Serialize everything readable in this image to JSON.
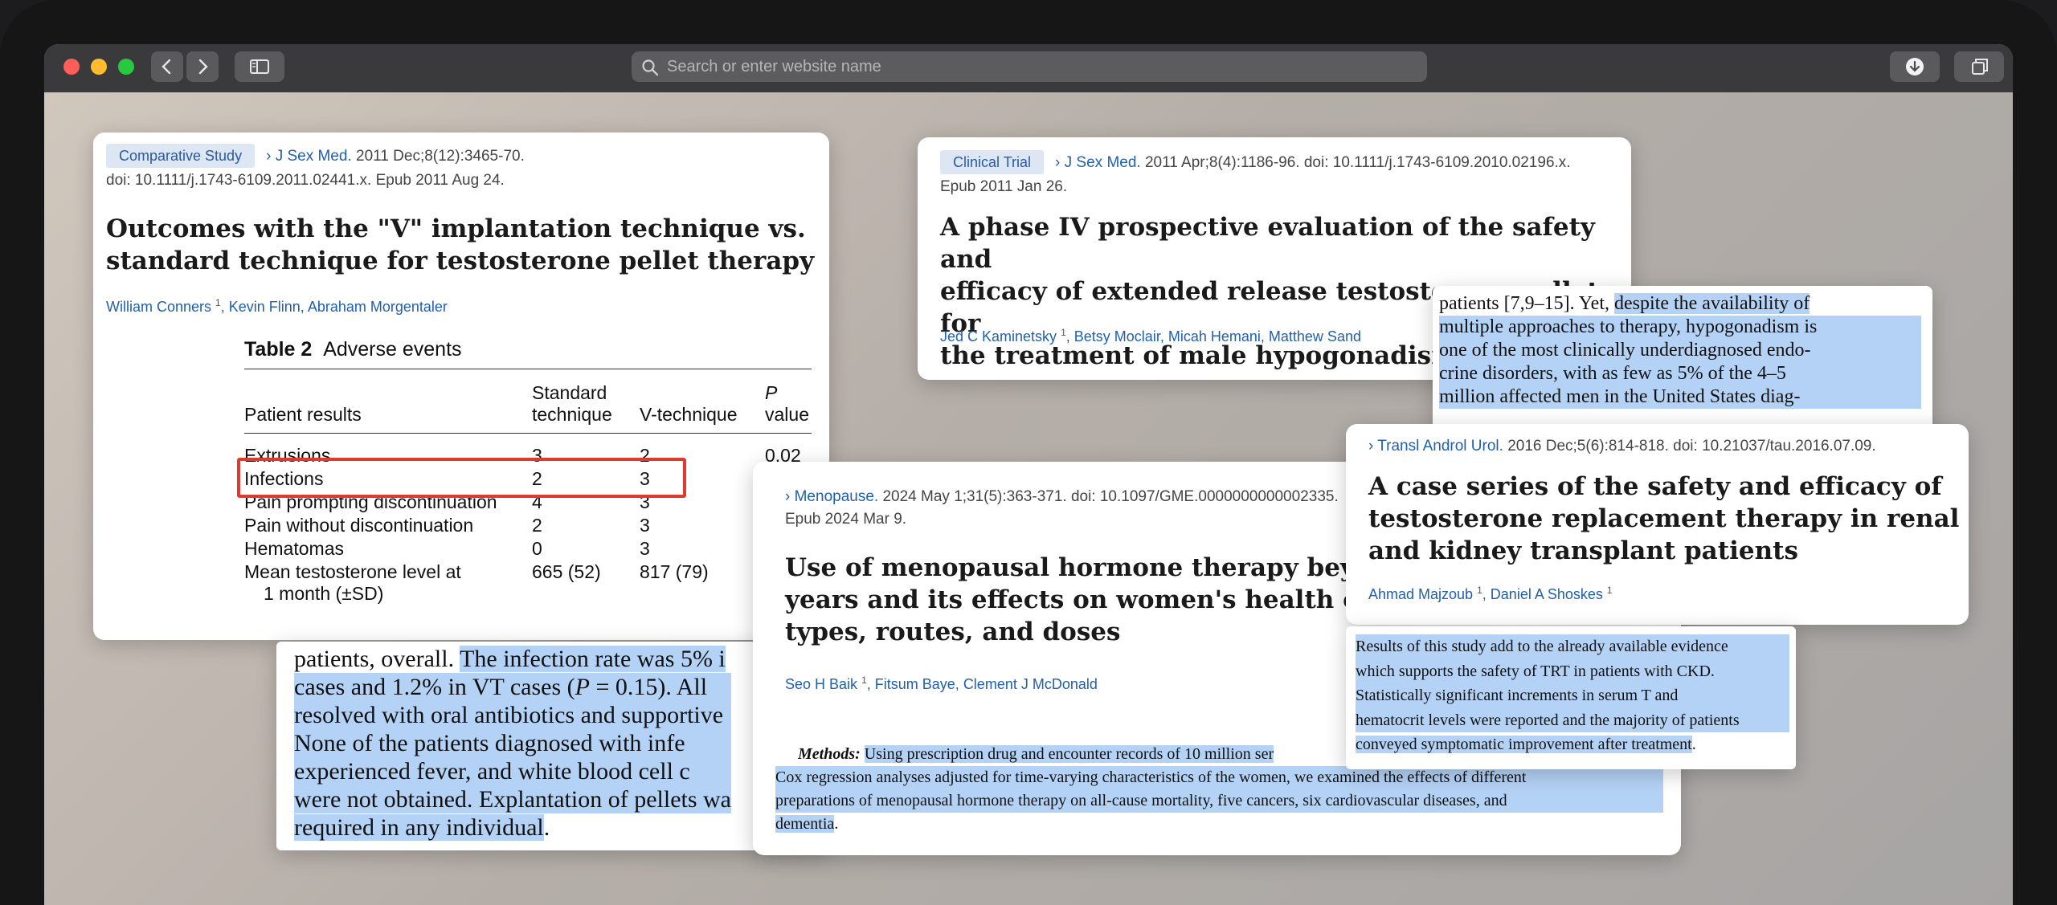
{
  "browser": {
    "search_placeholder": "Search or enter website name"
  },
  "card1": {
    "badge": "Comparative Study",
    "journal": "J Sex Med.",
    "citation": "2011 Dec;8(12):3465-70.",
    "doi_line": "doi: 10.1111/j.1743-6109.2011.02441.x. Epub 2011 Aug 24.",
    "title_line1": "Outcomes with the \"V\" implantation technique vs.",
    "title_line2": "standard technique for testosterone pellet therapy",
    "author1": "William Conners",
    "author1_sup": "1",
    "author2": "Kevin Flinn",
    "author3": "Abraham Morgentaler",
    "table": {
      "label": "Table 2",
      "caption": "Adverse events",
      "col_results": "Patient results",
      "col_standard_1": "Standard",
      "col_standard_2": "technique",
      "col_v": "V-technique",
      "col_p_1": "P",
      "col_p_2": "value",
      "rows": [
        {
          "name": "Extrusions",
          "std": "3",
          "v": "2",
          "p": "0.02"
        },
        {
          "name": "Infections",
          "std": "2",
          "v": "3",
          "p": ""
        },
        {
          "name": "Pain prompting discontinuation",
          "std": "4",
          "v": "3",
          "p": ""
        },
        {
          "name": "Pain without discontinuation",
          "std": "2",
          "v": "3",
          "p": ""
        },
        {
          "name": "Hematomas",
          "std": "0",
          "v": "3",
          "p": ""
        }
      ],
      "mean_row_line1": "Mean testosterone level at",
      "mean_row_line2": "1 month (±SD)",
      "mean_std": "665 (52)",
      "mean_v": "817 (79)"
    },
    "highlight_color": "#e03a2e"
  },
  "excerpt1": {
    "line1_plain": "patients, overall. ",
    "line1_hl": "The infection rate was 5% i",
    "line2": "cases and 1.2% in VT cases (",
    "line2_p": "P",
    "line2_rest": " = 0.15). All",
    "line3": "resolved with oral antibiotics and supportive",
    "line4": "None of the patients diagnosed with infe",
    "line5": "experienced fever, and white blood cell c",
    "line6": "were not obtained. Explantation of pellets wa",
    "line7": "required in any individual",
    "line7_end": "."
  },
  "card2": {
    "badge": "Clinical Trial",
    "journal": "J Sex Med.",
    "citation": "2011 Apr;8(4):1186-96. doi: 10.1111/j.1743-6109.2010.02196.x.",
    "epub": "Epub 2011 Jan 26.",
    "title_line1": "A phase IV prospective evaluation of the safety and",
    "title_line2": "efficacy of extended release testosterone pellets for",
    "title_line3": "the treatment of male hypogonadism",
    "author1": "Jed C Kaminetsky",
    "author1_sup": "1",
    "author2": "Betsy Moclair",
    "author3": "Micah Hemani",
    "author4": "Matthew Sand"
  },
  "excerpt2": {
    "line1_plain": "patients [7,9–15]. Yet, ",
    "line1_hl": "despite the availability of",
    "line2": "multiple approaches to therapy, hypogonadism is",
    "line3": "one of the most clinically underdiagnosed endo-",
    "line4": "crine disorders, with as few as 5% of the 4–5",
    "line5": "million affected men in the United States diag-"
  },
  "card3": {
    "journal": "Menopause.",
    "citation": "2024 May 1;31(5):363-371. doi: 10.1097/GME.0000000000002335.",
    "epub": "Epub 2024 Mar 9.",
    "title_line1": "Use of menopausal hormone therapy beyond ag",
    "title_line2": "years and its effects on women's health outcom",
    "title_line3": "types, routes, and doses",
    "author1": "Seo H Baik",
    "author1_sup": "1",
    "author2": "Fitsum Baye",
    "author3": "Clement J McDonald",
    "methods_label": "Methods:",
    "methods_line1": "Using prescription drug and encounter records of 10 million ser",
    "methods_line2": "Cox regression analyses adjusted for time-varying characteristics of the women, we examined the effects of different",
    "methods_line3": "preparations of menopausal hormone therapy on all-cause mortality, five cancers, six cardiovascular diseases, and",
    "methods_line4": "dementia",
    "methods_end": "."
  },
  "card4": {
    "journal": "Transl Androl Urol.",
    "citation": "2016 Dec;5(6):814-818. doi: 10.21037/tau.2016.07.09.",
    "title_line1": "A case series of the safety and efficacy of",
    "title_line2": "testosterone replacement therapy in renal failure",
    "title_line3": "and kidney transplant patients",
    "author1": "Ahmad Majzoub",
    "author1_sup": "1",
    "author2": "Daniel A Shoskes",
    "author2_sup": "1"
  },
  "excerpt4": {
    "line1": "Results of this study add to the already available evidence",
    "line2": "which supports the safety of TRT in patients with CKD.",
    "line3": "Statistically significant increments in serum T and",
    "line4": "hematocrit levels were reported and the majority of patients",
    "line5": "conveyed symptomatic improvement after treatment",
    "line5_end": "."
  }
}
